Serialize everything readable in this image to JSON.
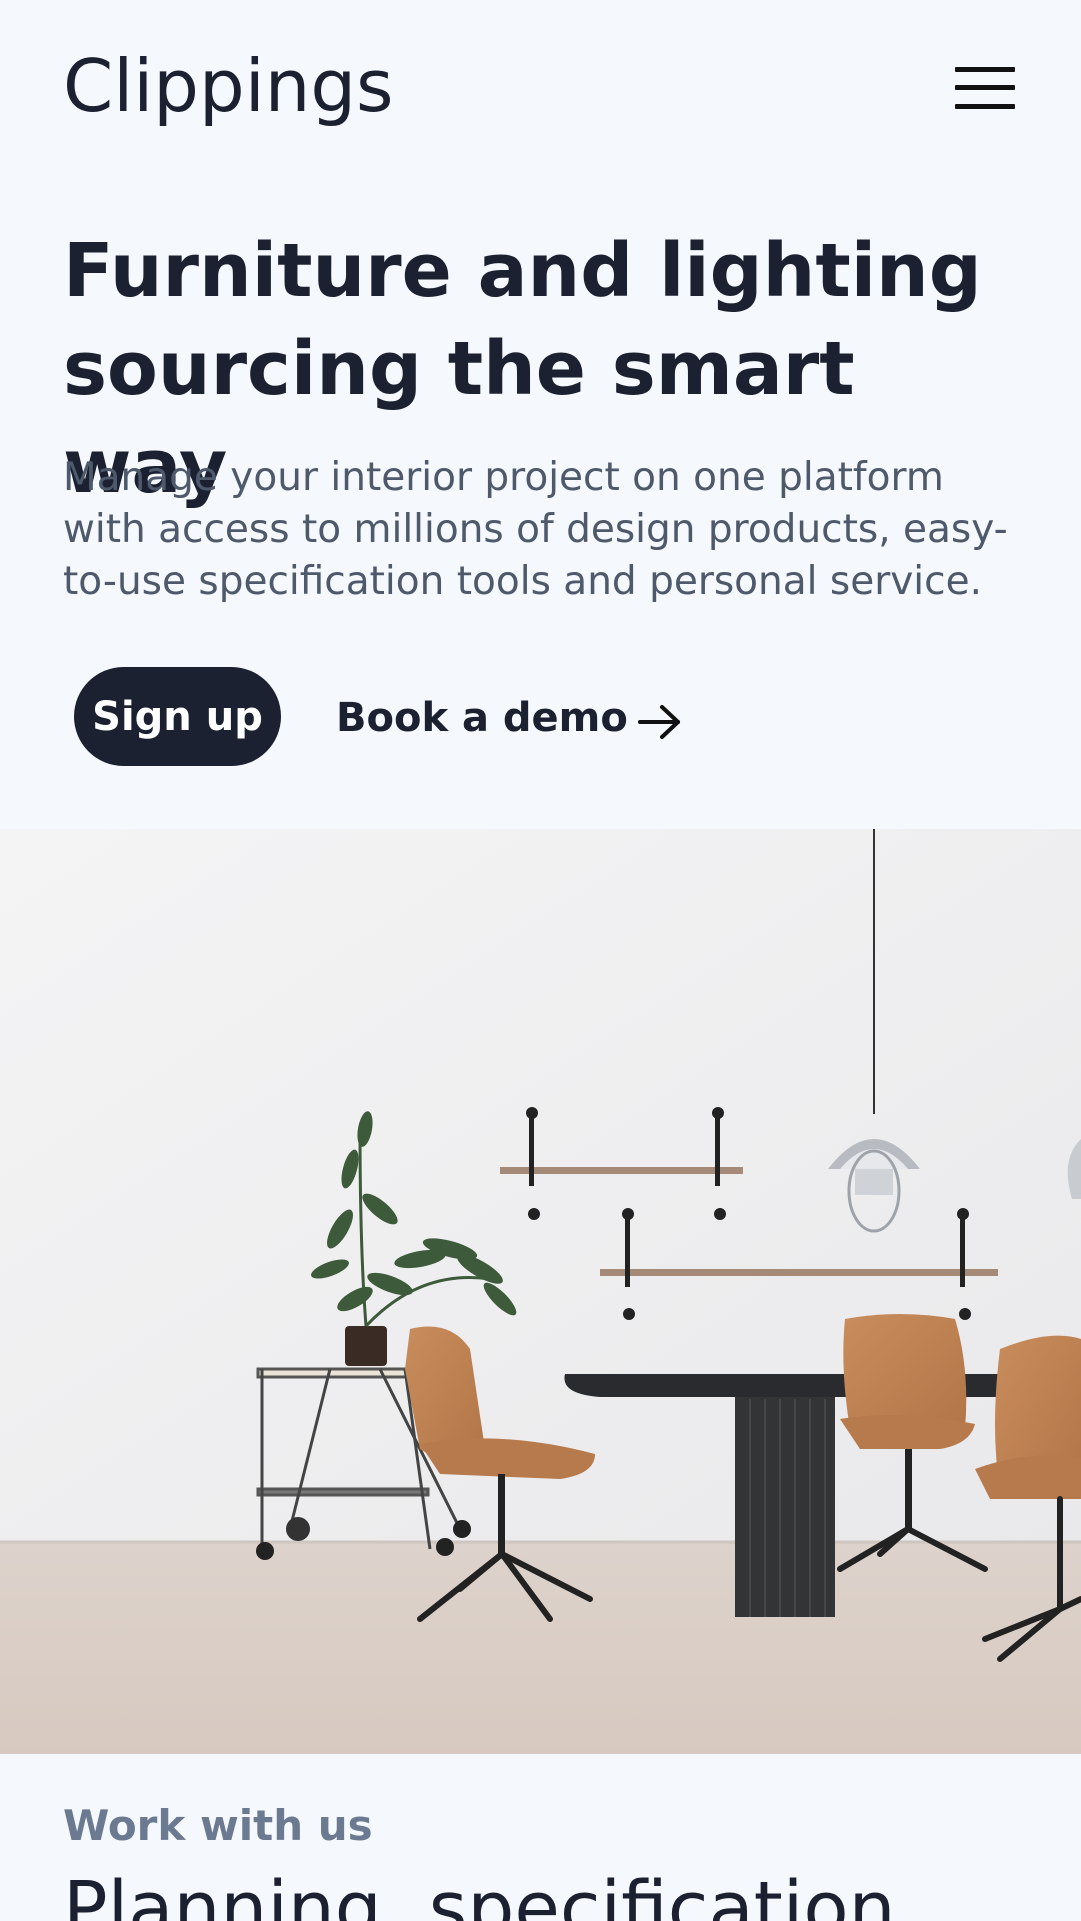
{
  "header": {
    "logo": "Clippings",
    "menu_icon": "hamburger-menu-icon"
  },
  "hero": {
    "title": "Furniture and lighting sourcing the smart way",
    "subtitle": "Manage your interior project on one platform with access to millions of design products, easy-to-use specification tools and personal service.",
    "signup_label": "Sign up",
    "demo_label": "Book a demo",
    "demo_icon": "arrow-right-icon",
    "image": "dining-room-photo"
  },
  "work_section": {
    "eyebrow": "Work with us",
    "title": "Planning, specification"
  },
  "colors": {
    "background": "#f5f8fc",
    "primary_dark": "#1b2130",
    "muted_text": "#4e5a6b",
    "eyebrow_text": "#6b7a90"
  }
}
